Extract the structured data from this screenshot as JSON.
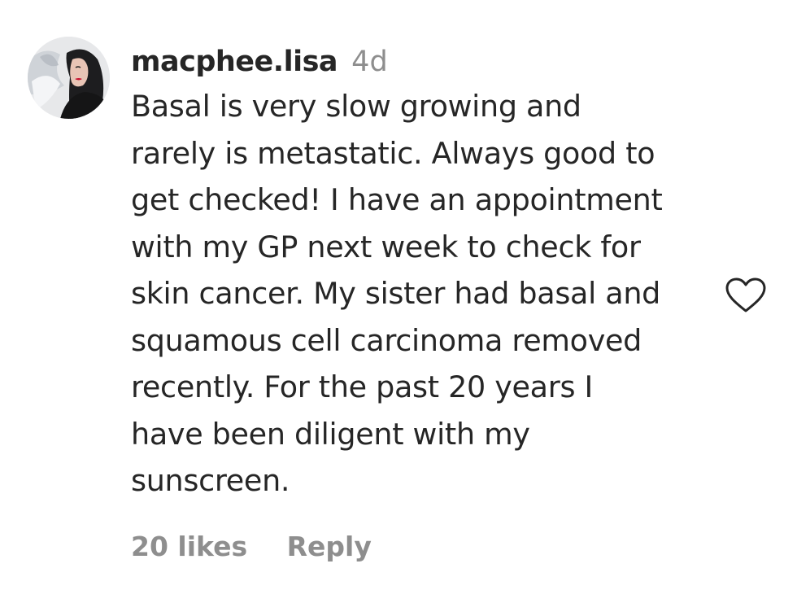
{
  "comment": {
    "username": "macphee.lisa",
    "timestamp": "4d",
    "text_lines": [
      "Basal is very slow growing and",
      "rarely is metastatic. Always good to",
      "get checked! I have an appointment",
      "with my GP next week to check for",
      "skin cancer. My sister had basal and",
      "squamous cell carcinoma removed",
      "recently. For the past 20 years I",
      "have been diligent with my",
      "sunscreen."
    ],
    "likes": "20 likes",
    "reply_label": "Reply",
    "like_icon": "heart-outline-icon",
    "avatar_icon": "profile-photo"
  },
  "colors": {
    "text": "#262626",
    "muted": "#8e8e8e",
    "background": "#ffffff"
  }
}
